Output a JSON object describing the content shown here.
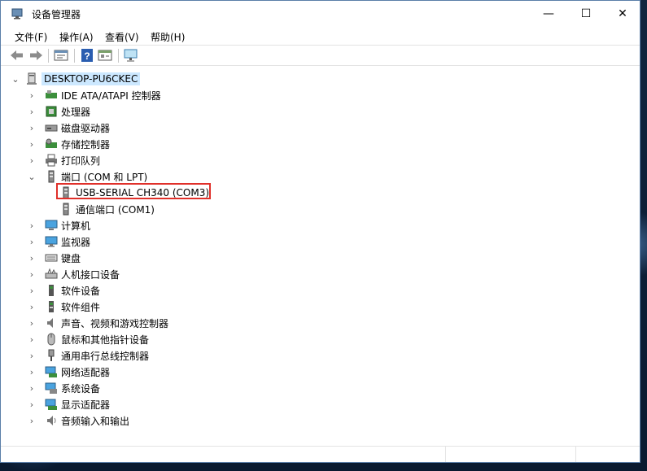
{
  "window": {
    "title": "设备管理器"
  },
  "window_controls": {
    "minimize": "—",
    "maximize": "☐",
    "close": "✕"
  },
  "menu": [
    {
      "label": "文件(F)"
    },
    {
      "label": "操作(A)"
    },
    {
      "label": "查看(V)"
    },
    {
      "label": "帮助(H)"
    }
  ],
  "toolbar": [
    "back",
    "forward",
    "properties",
    "help",
    "update-driver",
    "scan"
  ],
  "tree": {
    "root": {
      "label": "DESKTOP-PU6CKEC",
      "expanded": true
    },
    "items": [
      {
        "label": "IDE ATA/ATAPI 控制器",
        "icon": "ide-controller-icon",
        "expanded": false
      },
      {
        "label": "处理器",
        "icon": "processor-icon",
        "expanded": false
      },
      {
        "label": "磁盘驱动器",
        "icon": "disk-drive-icon",
        "expanded": false
      },
      {
        "label": "存储控制器",
        "icon": "storage-controller-icon",
        "expanded": false
      },
      {
        "label": "打印队列",
        "icon": "printer-icon",
        "expanded": false
      },
      {
        "label": "端口 (COM 和 LPT)",
        "icon": "port-icon",
        "expanded": true,
        "children": [
          {
            "label": "USB-SERIAL CH340 (COM3)",
            "icon": "port-device-icon",
            "highlighted": true
          },
          {
            "label": "通信端口 (COM1)",
            "icon": "port-device-icon",
            "highlighted": false
          }
        ]
      },
      {
        "label": "计算机",
        "icon": "computer-icon",
        "expanded": false
      },
      {
        "label": "监视器",
        "icon": "monitor-icon",
        "expanded": false
      },
      {
        "label": "键盘",
        "icon": "keyboard-icon",
        "expanded": false
      },
      {
        "label": "人机接口设备",
        "icon": "hid-icon",
        "expanded": false
      },
      {
        "label": "软件设备",
        "icon": "software-device-icon",
        "expanded": false
      },
      {
        "label": "软件组件",
        "icon": "software-component-icon",
        "expanded": false
      },
      {
        "label": "声音、视频和游戏控制器",
        "icon": "sound-icon",
        "expanded": false
      },
      {
        "label": "鼠标和其他指针设备",
        "icon": "mouse-icon",
        "expanded": false
      },
      {
        "label": "通用串行总线控制器",
        "icon": "usb-icon",
        "expanded": false
      },
      {
        "label": "网络适配器",
        "icon": "network-adapter-icon",
        "expanded": false
      },
      {
        "label": "系统设备",
        "icon": "system-device-icon",
        "expanded": false
      },
      {
        "label": "显示适配器",
        "icon": "display-adapter-icon",
        "expanded": false
      },
      {
        "label": "音频输入和输出",
        "icon": "audio-io-icon",
        "expanded": false
      }
    ]
  },
  "colors": {
    "highlight_border": "#e0302a",
    "selection": "#cce8ff"
  }
}
